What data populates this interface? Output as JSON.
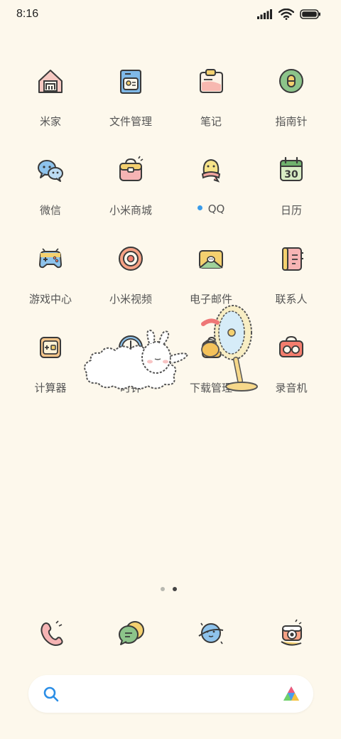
{
  "status_bar": {
    "time": "8:16",
    "icons": [
      "signal-icon",
      "wifi-icon",
      "battery-icon"
    ]
  },
  "apps": [
    {
      "label": "米家",
      "icon": "mi-home-icon"
    },
    {
      "label": "文件管理",
      "icon": "file-manager-icon"
    },
    {
      "label": "笔记",
      "icon": "notes-icon"
    },
    {
      "label": "指南针",
      "icon": "compass-icon"
    },
    {
      "label": "微信",
      "icon": "wechat-icon"
    },
    {
      "label": "小米商城",
      "icon": "mi-store-icon"
    },
    {
      "label": "QQ",
      "icon": "qq-icon",
      "notification_dot": true
    },
    {
      "label": "日历",
      "icon": "calendar-icon",
      "calendar_day": "30"
    },
    {
      "label": "游戏中心",
      "icon": "game-center-icon"
    },
    {
      "label": "小米视频",
      "icon": "mi-video-icon"
    },
    {
      "label": "电子邮件",
      "icon": "email-icon"
    },
    {
      "label": "联系人",
      "icon": "contacts-icon"
    },
    {
      "label": "计算器",
      "icon": "calculator-icon"
    },
    {
      "label": "时钟",
      "icon": "clock-icon"
    },
    {
      "label": "下载管理",
      "icon": "download-manager-icon"
    },
    {
      "label": "录音机",
      "icon": "recorder-icon"
    }
  ],
  "page_indicator": {
    "total": 2,
    "current": 2
  },
  "dock": [
    {
      "icon": "phone-icon"
    },
    {
      "icon": "messages-icon"
    },
    {
      "icon": "browser-icon"
    },
    {
      "icon": "camera-icon"
    }
  ],
  "colors": {
    "background": "#fdf8ec",
    "dot_active": "#444444",
    "dot_inactive": "#b8b8b0",
    "qq_dot": "#3a9bea"
  }
}
